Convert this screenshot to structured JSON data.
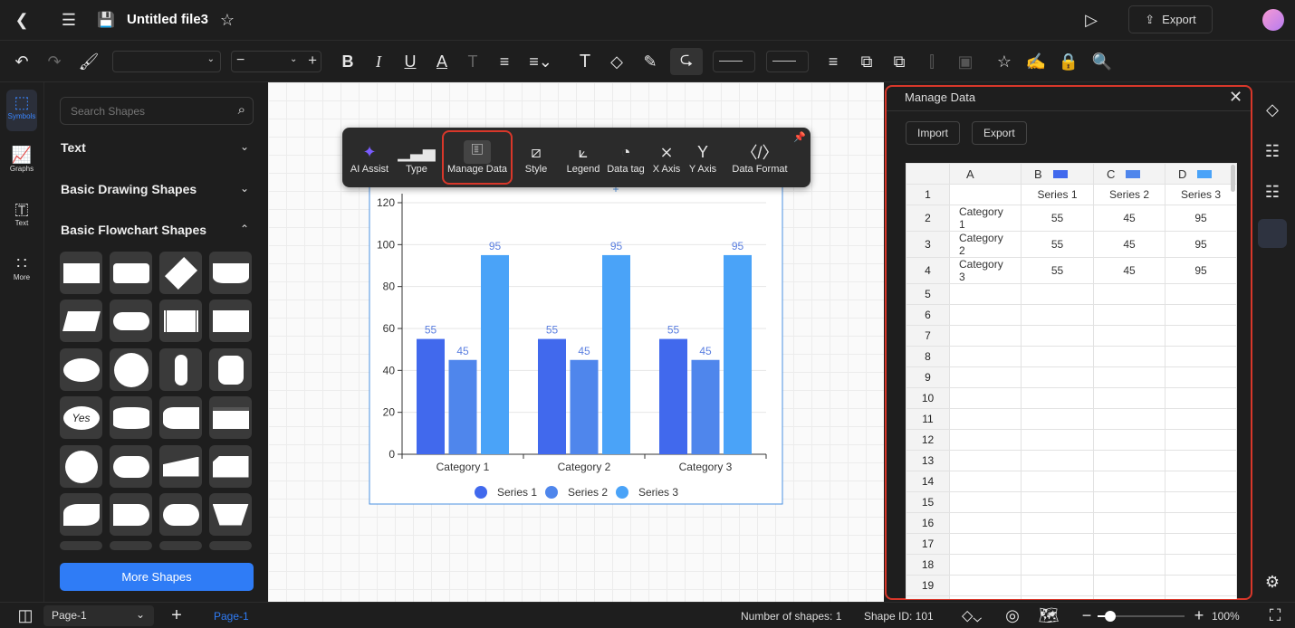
{
  "header": {
    "title": "Untitled file3",
    "export_label": "Export"
  },
  "toolbar": {
    "font_value": "",
    "size_value": ""
  },
  "rail": [
    {
      "label": "Symbols",
      "icon": "symbols-icon"
    },
    {
      "label": "Graphs",
      "icon": "graphs-icon"
    },
    {
      "label": "Text",
      "icon": "text-icon"
    },
    {
      "label": "More",
      "icon": "more-icon"
    }
  ],
  "shapes_panel": {
    "search_placeholder": "Search Shapes",
    "sections": [
      "Text",
      "Basic Drawing Shapes",
      "Basic Flowchart Shapes"
    ],
    "yes_label": "Yes",
    "more_shapes": "More Shapes"
  },
  "float_toolbar": [
    "AI Assist",
    "Type",
    "Manage Data",
    "Style",
    "Legend",
    "Data tag",
    "X Axis",
    "Y Axis",
    "Data Format"
  ],
  "chart_data": {
    "type": "bar",
    "categories": [
      "Category 1",
      "Category 2",
      "Category 3"
    ],
    "series": [
      {
        "name": "Series 1",
        "values": [
          55,
          55,
          55
        ],
        "color": "#4169ed"
      },
      {
        "name": "Series 2",
        "values": [
          45,
          45,
          45
        ],
        "color": "#4f86ec"
      },
      {
        "name": "Series 3",
        "values": [
          95,
          95,
          95
        ],
        "color": "#4aa3f8"
      }
    ],
    "ylim": [
      0,
      120
    ],
    "yticks": [
      "0",
      "20",
      "40",
      "60",
      "80",
      "100",
      "120"
    ],
    "legend": "bottom",
    "grid": true
  },
  "manage_data": {
    "title": "Manage Data",
    "import": "Import",
    "export": "Export",
    "columns": [
      "A",
      "B",
      "C",
      "D"
    ],
    "rows": [
      [
        "",
        "Series 1",
        "Series 2",
        "Series 3"
      ],
      [
        "Category 1",
        "55",
        "45",
        "95"
      ],
      [
        "Category 2",
        "55",
        "45",
        "95"
      ],
      [
        "Category 3",
        "55",
        "45",
        "95"
      ]
    ],
    "row_count": 20
  },
  "status": {
    "page_select": "Page-1",
    "page_tab": "Page-1",
    "shapes": "Number of shapes: 1",
    "shape_id": "Shape ID: 101",
    "zoom": "100%",
    "zoom_level": 0.3
  },
  "colors": {
    "accent": "#2f7cf6",
    "highlight": "#d8372a"
  }
}
